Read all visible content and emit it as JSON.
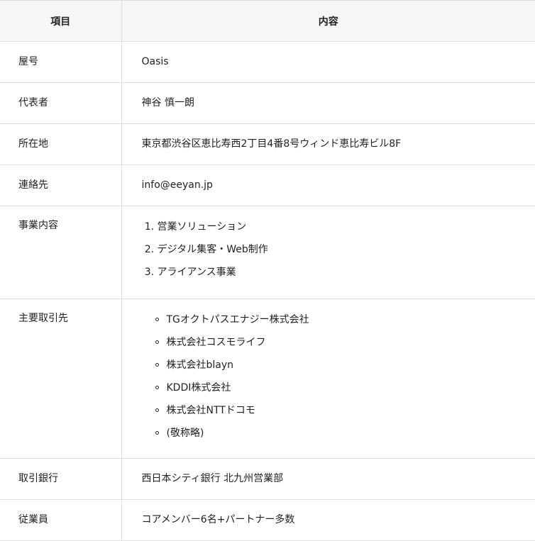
{
  "header": {
    "key_label": "項目",
    "value_label": "内容"
  },
  "rows": {
    "shop_name": {
      "key": "屋号",
      "value": "Oasis"
    },
    "representative": {
      "key": "代表者",
      "value": "神谷 慎一朗"
    },
    "address": {
      "key": "所在地",
      "value": "東京都渋谷区恵比寿西2丁目4番8号ウィンド恵比寿ビル8F"
    },
    "contact": {
      "key": "連絡先",
      "value": "info@eeyan.jp"
    },
    "business": {
      "key": "事業内容",
      "items": [
        "営業ソリューション",
        "デジタル集客・Web制作",
        "アライアンス事業"
      ]
    },
    "clients": {
      "key": "主要取引先",
      "items": [
        "TGオクトパスエナジー株式会社",
        "株式会社コスモライフ",
        "株式会社blayn",
        "KDDI株式会社",
        "株式会社NTTドコモ",
        "(敬称略)"
      ]
    },
    "bank": {
      "key": "取引銀行",
      "value": "西日本シティ銀行 北九州営業部"
    },
    "employees": {
      "key": "従業員",
      "value": "コアメンバー6名+パートナー多数"
    }
  }
}
